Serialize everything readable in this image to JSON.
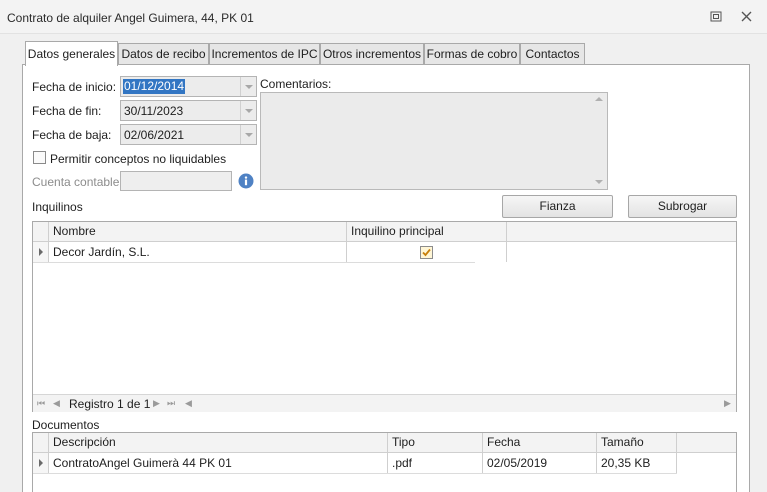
{
  "window": {
    "title": "Contrato de alquiler Angel Guimera, 44, PK 01"
  },
  "tabs": [
    {
      "label": "Datos generales",
      "active": true
    },
    {
      "label": "Datos de recibo",
      "active": false
    },
    {
      "label": "Incrementos de IPC",
      "active": false
    },
    {
      "label": "Otros incrementos",
      "active": false
    },
    {
      "label": "Formas de cobro",
      "active": false
    },
    {
      "label": "Contactos",
      "active": false
    }
  ],
  "form": {
    "fecha_inicio_label": "Fecha de inicio:",
    "fecha_inicio_value": "01/12/2014",
    "fecha_fin_label": "Fecha de fin:",
    "fecha_fin_value": "30/11/2023",
    "fecha_baja_label": "Fecha de baja:",
    "fecha_baja_value": "02/06/2021",
    "permitir_label": "Permitir conceptos no liquidables",
    "permitir_checked": false,
    "cuenta_label": "Cuenta contable:",
    "cuenta_value": "",
    "comentarios_label": "Comentarios:",
    "comentarios_value": ""
  },
  "inquilinos": {
    "section_label": "Inquilinos",
    "fianza_button": "Fianza",
    "subrogar_button": "Subrogar",
    "columns": [
      "Nombre",
      "Inquilino principal"
    ],
    "rows": [
      {
        "nombre": "Decor Jardín, S.L.",
        "principal": true
      }
    ],
    "navigator": {
      "record_text": "Registro 1 de 1"
    }
  },
  "documentos": {
    "section_label": "Documentos",
    "columns": [
      "Descripción",
      "Tipo",
      "Fecha",
      "Tamaño"
    ],
    "rows": [
      {
        "descripcion": "ContratoAngel Guimerà 44 PK 01",
        "tipo": ".pdf",
        "fecha": "02/05/2019",
        "tamano": "20,35 KB"
      }
    ]
  },
  "colors": {
    "selection": "#3276c3",
    "check_fill": "#fff6d6",
    "check_mark": "#c87f0a"
  },
  "icons": [
    "restore-icon",
    "close-icon",
    "info-icon",
    "first-record-icon",
    "prev-record-icon",
    "next-record-icon",
    "last-record-icon"
  ]
}
